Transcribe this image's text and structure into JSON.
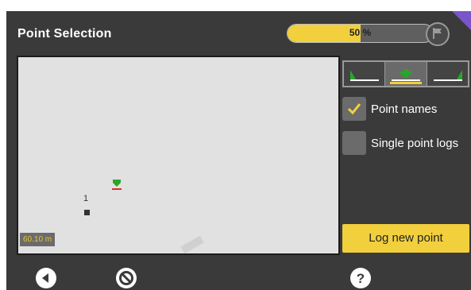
{
  "header": {
    "title": "Point Selection",
    "progress": {
      "label": "50 %",
      "value": 0.5
    },
    "flag_icon": "flag-icon"
  },
  "map": {
    "point_label": "1",
    "scale": "60.10 m",
    "rover_icon": "rover-marker-icon"
  },
  "height_selector": {
    "options": [
      "left-edge",
      "center",
      "right-edge"
    ],
    "selected": 1
  },
  "options": {
    "point_names": {
      "label": "Point names",
      "checked": true
    },
    "single_point_logs": {
      "label": "Single point logs",
      "checked": false
    }
  },
  "actions": {
    "log_new_point": "Log new point"
  },
  "footer": {
    "back_icon": "back-icon",
    "cancel_icon": "cancel-icon",
    "help_icon": "help-icon"
  },
  "colors": {
    "accent": "#f2cf3d",
    "background": "#3a3a3a",
    "map": "#e1e1e1",
    "marker_green": "#2aa52a",
    "marker_red": "#e12a2a",
    "corner": "#7a55c9"
  }
}
